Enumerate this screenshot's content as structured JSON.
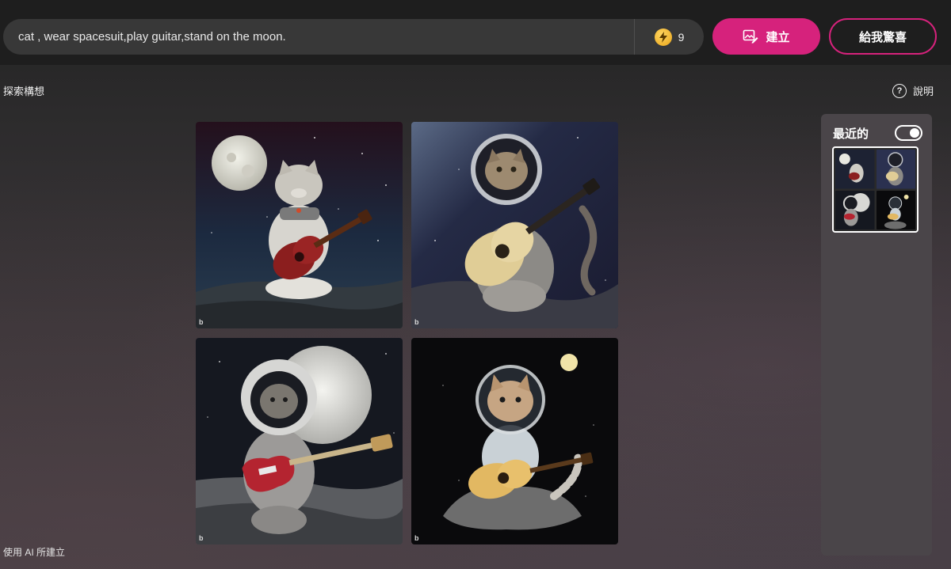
{
  "search": {
    "value": "cat , wear spacesuit,play guitar,stand on the moon."
  },
  "boosts": {
    "count": "9",
    "icon": "lightning-coin-icon"
  },
  "buttons": {
    "create_label": "建立",
    "surprise_label": "給我驚喜"
  },
  "nav": {
    "explore_label": "探索構想",
    "help_label": "說明",
    "help_glyph": "?"
  },
  "images": [
    {
      "name": "cat-red-guitar-moon",
      "watermark": "b"
    },
    {
      "name": "cat-helmet-acoustic-guitar",
      "watermark": "b"
    },
    {
      "name": "cat-spacesuit-electric-guitar",
      "watermark": "b"
    },
    {
      "name": "cat-on-rock-guitar",
      "watermark": "b"
    }
  ],
  "recent": {
    "title": "最近的",
    "toggle_on": true
  },
  "footer": {
    "text": "使用 AI 所建立"
  },
  "colors": {
    "accent": "#d6227c",
    "topbar": "#1e1e1e",
    "search_bg": "#383838",
    "panel": "#4a4549"
  }
}
